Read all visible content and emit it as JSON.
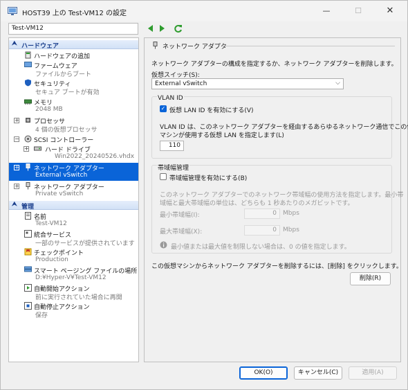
{
  "window": {
    "title": "HOST39 上の Test-VM12 の設定"
  },
  "toolbar": {
    "vm_select_value": "Test-VM12"
  },
  "tree": {
    "hardware_header": "ハードウェア",
    "management_header": "管理",
    "items": [
      {
        "label": "ハードウェアの追加",
        "sub": ""
      },
      {
        "label": "ファームウェア",
        "sub": "ファイルからブート"
      },
      {
        "label": "セキュリティ",
        "sub": "セキュア ブートが有効"
      },
      {
        "label": "メモリ",
        "sub": "2048 MB"
      },
      {
        "label": "プロセッサ",
        "sub": "4 個の仮想プロセッサ"
      },
      {
        "label": "SCSI コントローラー",
        "sub": ""
      },
      {
        "label": "ハード ドライブ",
        "sub": "Win2022_20240526.vhdx"
      },
      {
        "label": "ネットワーク アダプター",
        "sub": "External vSwitch"
      },
      {
        "label": "ネットワーク アダプター",
        "sub": "Private vSwitch"
      }
    ],
    "mgmt_items": [
      {
        "label": "名前",
        "sub": "Test-VM12"
      },
      {
        "label": "統合サービス",
        "sub": "一部のサービスが提供されています"
      },
      {
        "label": "チェックポイント",
        "sub": "Production"
      },
      {
        "label": "スマート ページング ファイルの場所",
        "sub": "D:¥Hyper-V¥Test-VM12"
      },
      {
        "label": "自動開始アクション",
        "sub": "前に実行されていた場合に再開"
      },
      {
        "label": "自動停止アクション",
        "sub": "保存"
      }
    ]
  },
  "panel": {
    "section_title": "ネットワーク アダプター",
    "intro": "ネットワーク アダプターの構成を指定するか、ネットワーク アダプターを削除します。",
    "switch_label": "仮想スイッチ(S):",
    "switch_value": "External vSwitch",
    "vlan_group": "VLAN ID",
    "vlan_checkbox": "仮想 LAN ID を有効にする(V)",
    "vlan_desc1": "VLAN ID は、このネットワーク アダプターを経由するあらゆるネットワーク通信でこの仮想",
    "vlan_desc2": "マシンが使用する仮想 LAN を指定します(L)",
    "vlan_value": "110",
    "bw_group": "帯域幅管理",
    "bw_checkbox": "帯域幅管理を有効にする(B)",
    "bw_desc1": "このネットワーク アダプターでのネットワーク帯域幅の使用方法を指定します。最小帯",
    "bw_desc2": "域幅と最大帯域幅の単位は、どちらも 1 秒あたりのメガビットです。",
    "bw_min_label": "最小帯域幅(I):",
    "bw_min_value": "0",
    "bw_max_label": "最大帯域幅(X):",
    "bw_max_value": "0",
    "bw_unit": "Mbps",
    "bw_info": "最小値または最大値を制限しない場合は、0 の値を指定します。",
    "remove_hint": "この仮想マシンからネットワーク アダプターを削除するには、[削除] をクリックします。",
    "remove_button": "削除(R)"
  },
  "footer": {
    "ok": "OK(O)",
    "cancel": "キャンセル(C)",
    "apply": "適用(A)"
  },
  "colors": {
    "accent": "#0a64d8",
    "nav_green": "#2e9c2e"
  }
}
